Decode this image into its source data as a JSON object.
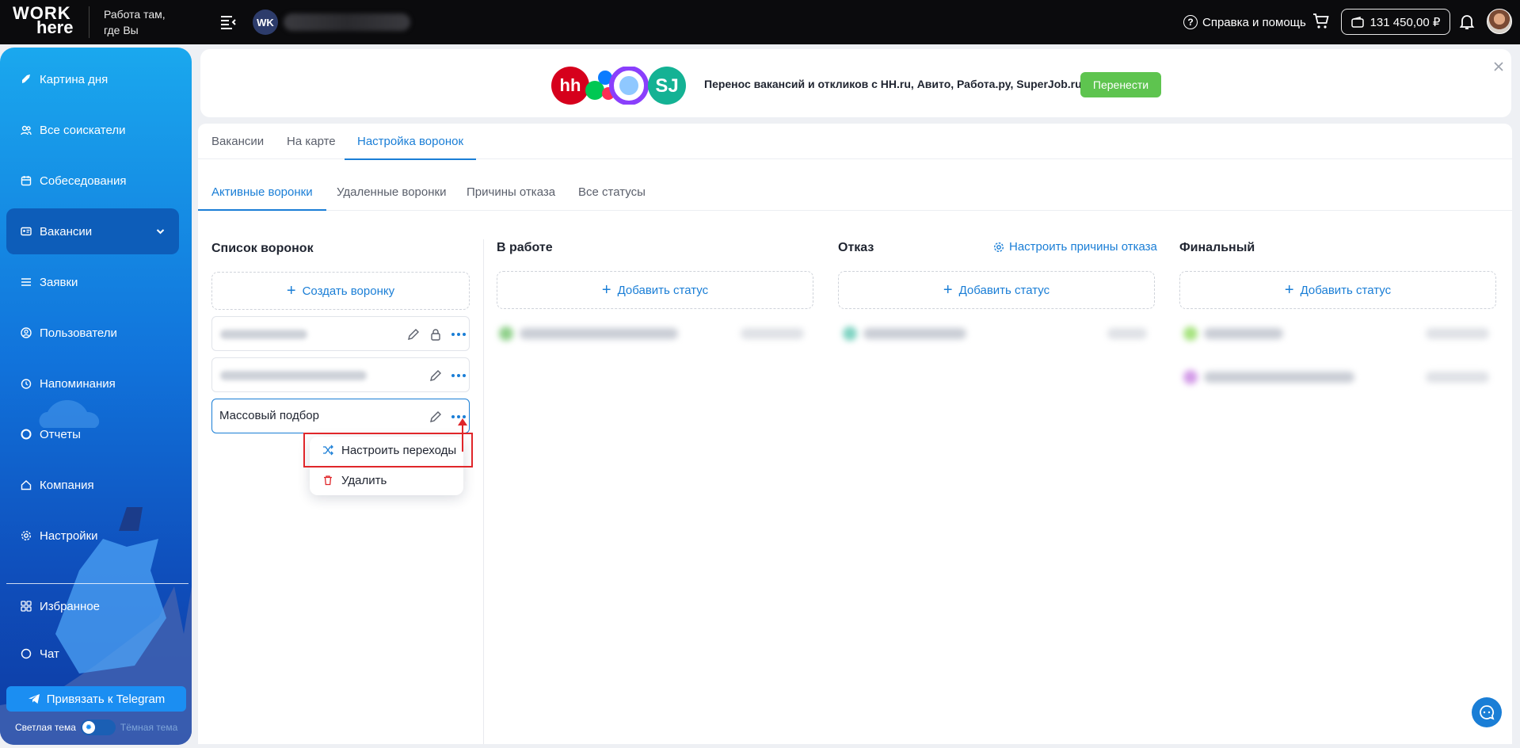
{
  "topbar": {
    "logo_line1": "WORK",
    "logo_line2": "here",
    "slogan_line1": "Работа там,",
    "slogan_line2": "где Вы",
    "company_avatar": "WK",
    "help_label": "Справка и помощь",
    "balance": "131 450,00 ₽"
  },
  "sidebar": {
    "items": [
      {
        "label": "Картина дня",
        "icon": "rocket-icon"
      },
      {
        "label": "Все соискатели",
        "icon": "people-icon"
      },
      {
        "label": "Собеседования",
        "icon": "calendar-icon"
      },
      {
        "label": "Вакансии",
        "icon": "id-card-icon"
      },
      {
        "label": "Заявки",
        "icon": "list-icon"
      },
      {
        "label": "Пользователи",
        "icon": "user-circle-icon"
      },
      {
        "label": "Напоминания",
        "icon": "alarm-icon"
      },
      {
        "label": "Отчеты",
        "icon": "pie-chart-icon"
      },
      {
        "label": "Компания",
        "icon": "home-icon"
      },
      {
        "label": "Настройки",
        "icon": "gear-icon"
      },
      {
        "label": "Избранное",
        "icon": "grid-icon"
      },
      {
        "label": "Чат",
        "icon": "chat-icon"
      }
    ],
    "telegram_button": "Привязать к Telegram",
    "theme_light": "Светлая тема",
    "theme_dark": "Тёмная тема"
  },
  "banner": {
    "text": "Перенос вакансий и откликов с HH.ru, Авито, Работа.ру, SuperJob.ru",
    "button": "Перенести",
    "logo_hh": "hh",
    "logo_sj": "SJ"
  },
  "tabs_main": [
    "Вакансии",
    "На карте",
    "Настройка воронок"
  ],
  "tabs_sub": [
    "Активные воронки",
    "Удаленные воронки",
    "Причины отказа",
    "Все статусы"
  ],
  "funnels": {
    "title": "Список воронок",
    "create_button": "Создать воронку",
    "selected_name": "Массовый подбор"
  },
  "columns": {
    "in_work": "В работе",
    "reject": "Отказ",
    "final": "Финальный",
    "add_status": "Добавить статус",
    "reject_settings": "Настроить причины отказа"
  },
  "popover": {
    "configure": "Настроить переходы",
    "delete": "Удалить"
  },
  "colors": {
    "accent": "#1a7ed6",
    "success": "#5ec44f",
    "danger": "#e0262a",
    "sidebar_top": "#1aa8ee",
    "sidebar_bottom": "#0e3aa2"
  }
}
